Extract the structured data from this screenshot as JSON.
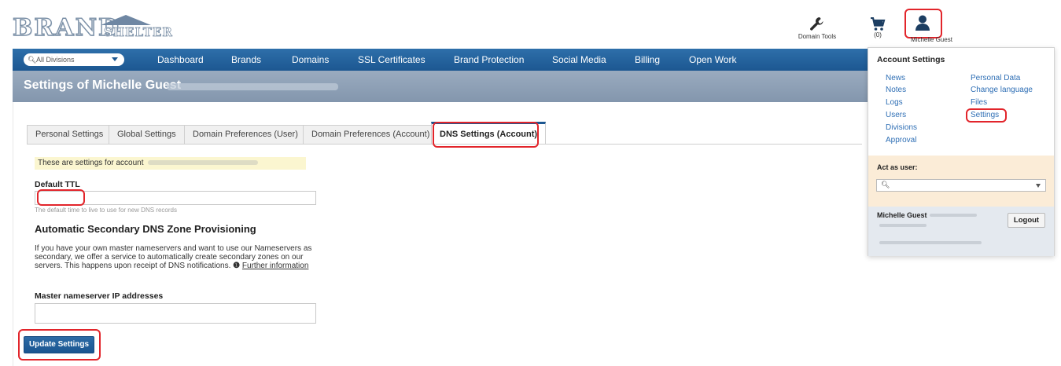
{
  "header": {
    "logo_main": "BRAND",
    "logo_sub": "SHELTER",
    "domain_tools_label": "Domain Tools",
    "cart_count": "(0)",
    "user_name": "Michelle Guest"
  },
  "nav": {
    "division_placeholder": "All Divisions",
    "items": [
      "Dashboard",
      "Brands",
      "Domains",
      "SSL Certificates",
      "Brand Protection",
      "Social Media",
      "Billing",
      "Open Work"
    ]
  },
  "page": {
    "title": "Settings of Michelle Guest"
  },
  "tabs": [
    "Personal Settings",
    "Global Settings",
    "Domain Preferences (User)",
    "Domain Preferences (Account)",
    "DNS Settings (Account)"
  ],
  "form": {
    "notice": "These are settings for account",
    "default_ttl_label": "Default TTL",
    "default_ttl_value": "",
    "default_ttl_hint": "The default time to live to use for new DNS records",
    "section_title": "Automatic Secondary DNS Zone Provisioning",
    "description": "If you have your own master nameservers and want to use our Nameservers as secondary, we offer a service to automatically create secondary zones on our servers. This happens upon receipt of DNS notifications.",
    "info_icon": "❶",
    "further_info": "Further information",
    "master_ns_label": "Master nameserver IP addresses",
    "master_ns_value": "",
    "update_button": "Update Settings"
  },
  "account_menu": {
    "title": "Account Settings",
    "left_links": [
      "News",
      "Notes",
      "Logs",
      "Users",
      "Divisions",
      "Approval"
    ],
    "right_links": [
      "Personal Data",
      "Change language",
      "Files",
      "Settings"
    ],
    "act_as_label": "Act as user:",
    "act_as_placeholder": "",
    "footer_name": "Michelle Guest",
    "logout": "Logout"
  },
  "colors": {
    "nav_blue": "#1c5791",
    "title_band": "#8396ad",
    "link_blue": "#2f6fb5",
    "highlight_red": "#e2252b",
    "notice_yellow": "#fbf6d0",
    "act_as_bg": "#fbecd7"
  },
  "icons": {
    "domain_tools": "wrench-icon",
    "cart": "cart-icon",
    "user": "user-icon",
    "search": "search-icon",
    "info": "info-icon"
  }
}
